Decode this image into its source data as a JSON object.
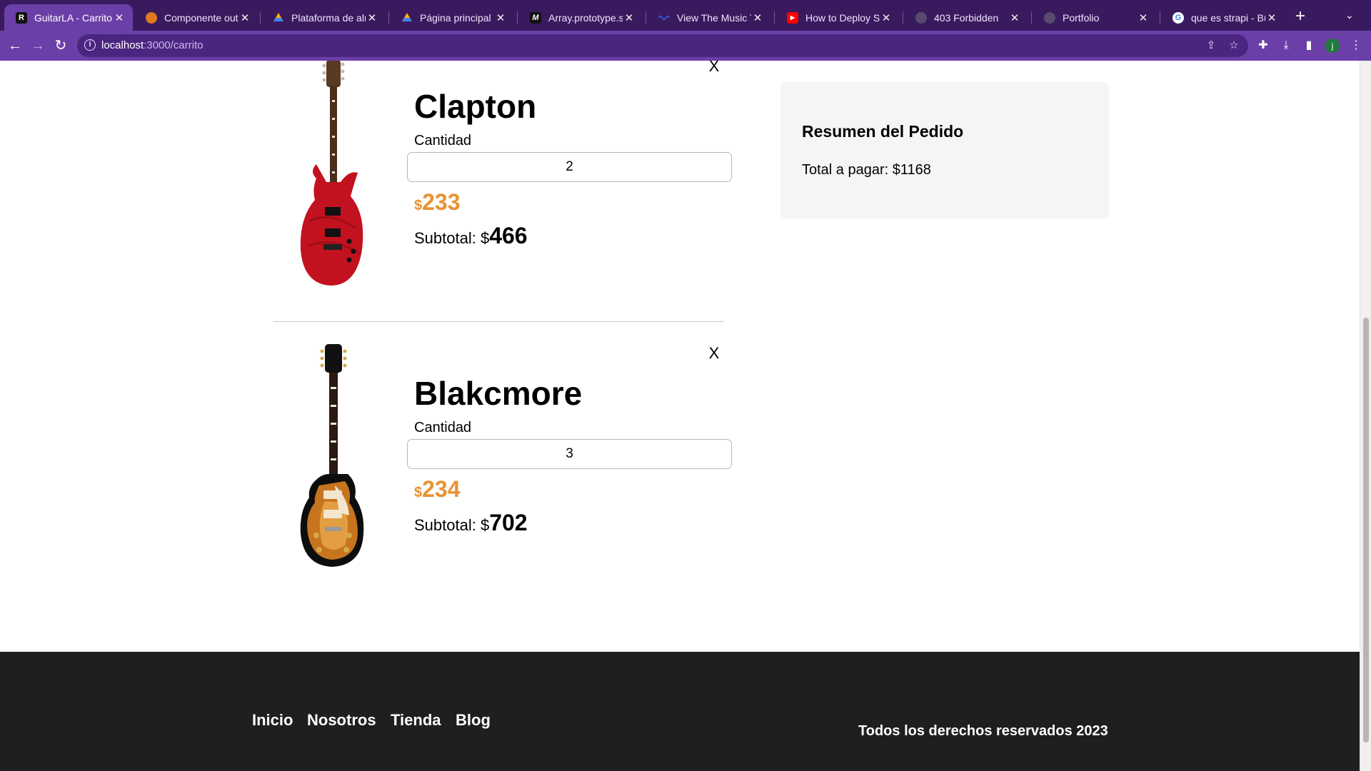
{
  "browser": {
    "tabs": [
      {
        "title": "GuitarLA - Carrito d",
        "active": true,
        "favicon": "guitarla-icon"
      },
      {
        "title": "Componente outlet",
        "active": false,
        "favicon": "orange-icon"
      },
      {
        "title": "Plataforma de alma",
        "active": false,
        "favicon": "drive-icon"
      },
      {
        "title": "Página principal - G",
        "active": false,
        "favicon": "drive-icon"
      },
      {
        "title": "Array.prototype.sor",
        "active": false,
        "favicon": "mdn-icon"
      },
      {
        "title": "View The Music Tra",
        "active": false,
        "favicon": "wave-icon"
      },
      {
        "title": "How to Deploy Stra",
        "active": false,
        "favicon": "youtube-icon"
      },
      {
        "title": "403 Forbidden",
        "active": false,
        "favicon": "globe-icon"
      },
      {
        "title": "Portfolio",
        "active": false,
        "favicon": "globe-icon"
      },
      {
        "title": "que es strapi - Bus",
        "active": false,
        "favicon": "google-icon"
      }
    ],
    "url_host": "localhost",
    "url_path": ":3000/carrito",
    "profile_initial": "j",
    "colors": {
      "frame": "#3a1a5e",
      "toolbar": "#6b3fa8"
    }
  },
  "cart": {
    "items": [
      {
        "name": "Clapton",
        "qty_label": "Cantidad",
        "qty": "2",
        "currency": "$",
        "price": "233",
        "subtotal_label": "Subtotal: $",
        "subtotal": "466",
        "remove": "X"
      },
      {
        "name": "Blakcmore",
        "qty_label": "Cantidad",
        "qty": "3",
        "currency": "$",
        "price": "234",
        "subtotal_label": "Subtotal: $",
        "subtotal": "702",
        "remove": "X"
      }
    ],
    "price_color": "#e99232"
  },
  "summary": {
    "title": "Resumen del Pedido",
    "total": "Total a pagar: $1168"
  },
  "footer": {
    "links": [
      "Inicio",
      "Nosotros",
      "Tienda",
      "Blog"
    ],
    "copyright": "Todos los derechos reservados 2023"
  }
}
